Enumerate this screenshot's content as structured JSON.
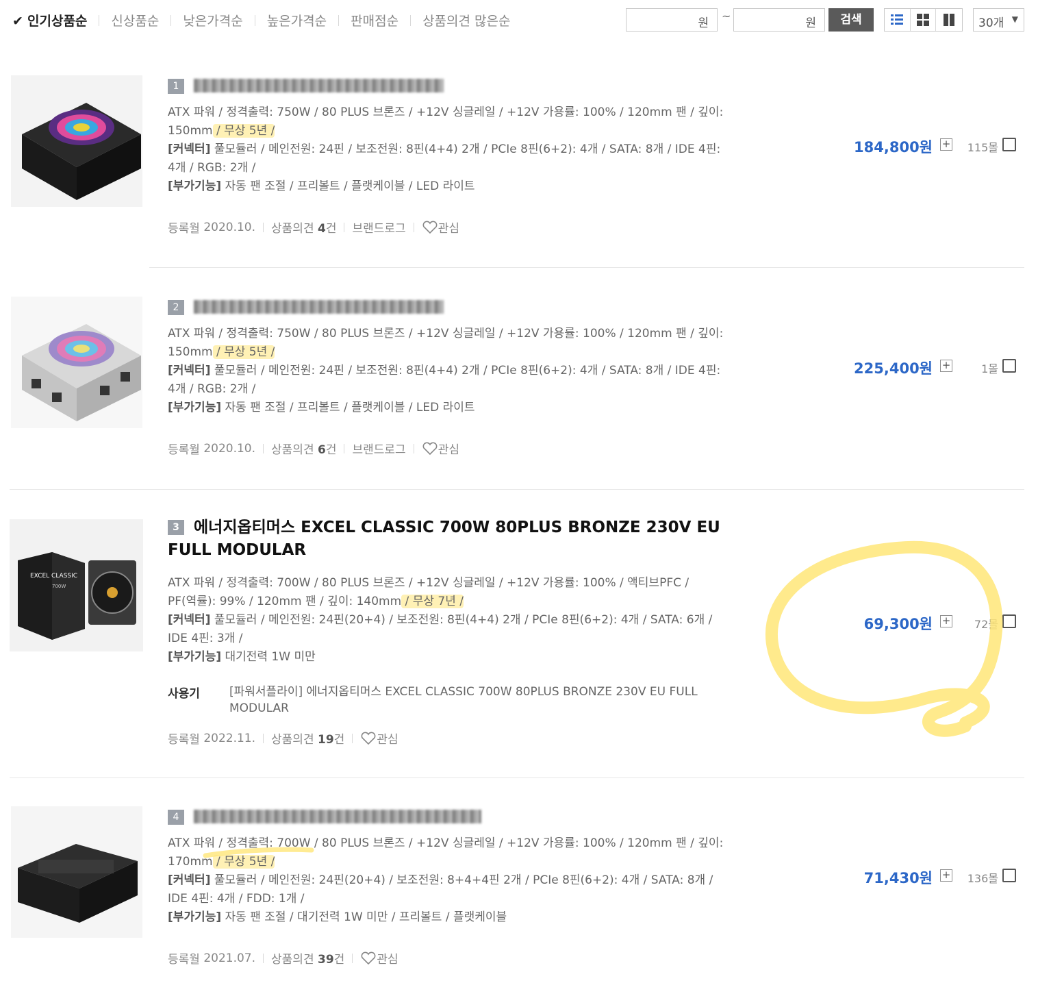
{
  "sort_tabs": [
    {
      "label": "인기상품순",
      "active": true
    },
    {
      "label": "신상품순"
    },
    {
      "label": "낮은가격순"
    },
    {
      "label": "높은가격순"
    },
    {
      "label": "판매점순"
    },
    {
      "label": "상품의견 많은순"
    }
  ],
  "price_filter": {
    "unit": "원",
    "tilde": "~",
    "search_label": "검색"
  },
  "view_modes": [
    "list-view-icon",
    "grid-view-icon",
    "column-view-icon"
  ],
  "count_select": {
    "value": "30개"
  },
  "products": [
    {
      "rank": "1",
      "name_blurred": true,
      "spec_line1a": "ATX 파워 / 정격출력: 750W / 80 PLUS 브론즈 / +12V 싱글레일 / +12V 가용률: 100% / 120mm 팬 / 깊이:",
      "spec_line1b": "150mm",
      "spec_warranty": " / 무상 5년 /",
      "connector_label": "[커넥터]",
      "connector_a": " 풀모듈러 / 메인전원: 24핀 / 보조전원: 8핀(4+4) 2개 / PCIe 8핀(6+2): 4개 / SATA: 8개 / IDE 4핀:",
      "connector_b": "4개 / RGB: 2개 /",
      "extra_label": "[부가기능]",
      "extra": " 자동 팬 조절 / 프리볼트 / 플랫케이블 / LED 라이트",
      "reg_label": "등록월",
      "reg_date": "2020.10.",
      "opinion_label": "상품의견",
      "opinion_count": "4",
      "opinion_unit": "건",
      "brand_log": "브랜드로그",
      "wish": "관심",
      "price": "184,800원",
      "mall": "115몰"
    },
    {
      "rank": "2",
      "name_blurred": true,
      "spec_line1a": "ATX 파워 / 정격출력: 750W / 80 PLUS 브론즈 / +12V 싱글레일 / +12V 가용률: 100% / 120mm 팬 / 깊이:",
      "spec_line1b": "150mm",
      "spec_warranty": " / 무상 5년 /",
      "connector_label": "[커넥터]",
      "connector_a": " 풀모듈러 / 메인전원: 24핀 / 보조전원: 8핀(4+4) 2개 / PCIe 8핀(6+2): 4개 / SATA: 8개 / IDE 4핀:",
      "connector_b": "4개 / RGB: 2개 /",
      "extra_label": "[부가기능]",
      "extra": " 자동 팬 조절 / 프리볼트 / 플랫케이블 / LED 라이트",
      "reg_label": "등록월",
      "reg_date": "2020.10.",
      "opinion_label": "상품의견",
      "opinion_count": "6",
      "opinion_unit": "건",
      "brand_log": "브랜드로그",
      "wish": "관심",
      "price": "225,400원",
      "mall": "1몰"
    },
    {
      "rank": "3",
      "name": "에너지옵티머스 EXCEL CLASSIC 700W 80PLUS BRONZE 230V EU FULL MODULAR",
      "spec_line1a": "ATX 파워 / 정격출력: 700W / 80 PLUS 브론즈 / +12V 싱글레일 / +12V 가용률: 100% / 액티브PFC /",
      "spec_line1b": "PF(역률): 99% / 120mm 팬 / 깊이: 140mm",
      "spec_warranty": " / 무상 7년 /",
      "connector_label": "[커넥터]",
      "connector_a": " 풀모듈러 / 메인전원: 24핀(20+4) / 보조전원: 8핀(4+4) 2개 / PCIe 8핀(6+2): 4개 / SATA: 6개 /",
      "connector_b": "IDE 4핀: 3개 /",
      "extra_label": "[부가기능]",
      "extra": " 대기전력 1W 미만",
      "usage_label": "사용기",
      "usage_text": "[파워서플라이] 에너지옵티머스 EXCEL CLASSIC 700W 80PLUS BRONZE 230V EU FULL MODULAR",
      "reg_label": "등록월",
      "reg_date": "2022.11.",
      "opinion_label": "상품의견",
      "opinion_count": "19",
      "opinion_unit": "건",
      "wish": "관심",
      "price": "69,300원",
      "mall": "72몰",
      "box_label": "EXCEL CLASSIC",
      "box_watt": "700W"
    },
    {
      "rank": "4",
      "name_blurred": true,
      "spec_line1a": "ATX 파워 / 정격출력: 700W / 80 PLUS 브론즈 / +12V 싱글레일 / +12V 가용률: 100% / 120mm 팬 / 깊이:",
      "spec_line1b": "170mm",
      "spec_warranty": " / 무상 5년 /",
      "connector_label": "[커넥터]",
      "connector_a": " 풀모듈러 / 메인전원: 24핀(20+4) / 보조전원: 8+4+4핀 2개 / PCIe 8핀(6+2): 4개 / SATA: 8개 /",
      "connector_b": "IDE 4핀: 4개 / FDD: 1개 /",
      "extra_label": "[부가기능]",
      "extra": " 자동 팬 조절 / 대기전력 1W 미만 / 프리볼트 / 플랫케이블",
      "reg_label": "등록월",
      "reg_date": "2021.07.",
      "opinion_label": "상품의견",
      "opinion_count": "39",
      "opinion_unit": "건",
      "wish": "관심",
      "price": "71,430원",
      "mall": "136몰"
    }
  ],
  "colors": {
    "price_blue": "#2c67c7",
    "highlight_yellow": "#ffe678",
    "search_button": "#5a5a5a"
  }
}
